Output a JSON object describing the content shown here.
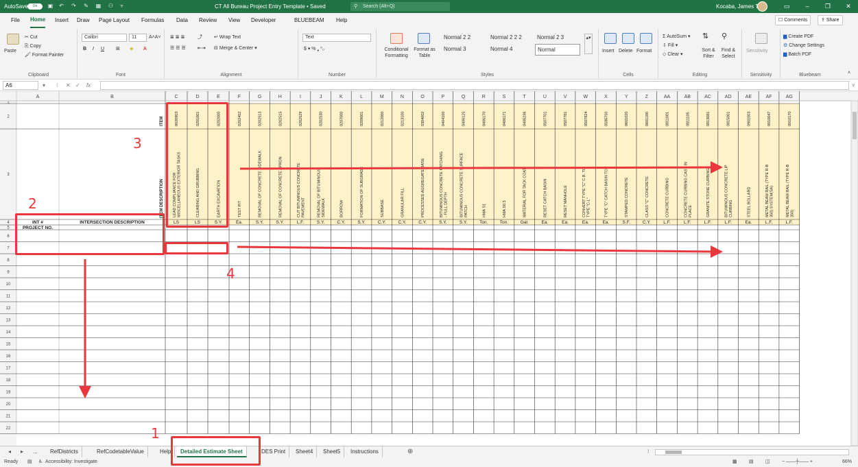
{
  "titlebar": {
    "autosave_label": "AutoSave",
    "autosave_state": "On",
    "doc_title": "CT All Bureau Project Entry Template • Saved",
    "search_placeholder": "Search (Alt+Q)",
    "user_name": "Kocaba, James T"
  },
  "menu": {
    "tabs": [
      "File",
      "Home",
      "Insert",
      "Draw",
      "Page Layout",
      "Formulas",
      "Data",
      "Review",
      "View",
      "Developer",
      "BLUEBEAM",
      "Help"
    ],
    "active": "Home",
    "comments": "Comments",
    "share": "Share"
  },
  "ribbon": {
    "clipboard": {
      "label": "Clipboard",
      "paste": "Paste",
      "cut": "Cut",
      "copy": "Copy",
      "format_painter": "Format Painter"
    },
    "font": {
      "label": "Font",
      "name": "Calibri",
      "size": "11"
    },
    "alignment": {
      "label": "Alignment",
      "wrap": "Wrap Text",
      "merge": "Merge & Center"
    },
    "number": {
      "label": "Number",
      "format": "Text"
    },
    "styles": {
      "label": "Styles",
      "conditional": "Conditional Formatting",
      "format_table": "Format as Table",
      "cells": [
        "Normal 2 2",
        "Normal 2 2 2",
        "Normal 2 3",
        "Normal 3",
        "Normal 4",
        "Normal"
      ]
    },
    "cells": {
      "label": "Cells",
      "insert": "Insert",
      "delete": "Delete",
      "format": "Format"
    },
    "editing": {
      "label": "Editing",
      "autosum": "AutoSum",
      "fill": "Fill",
      "clear": "Clear",
      "sort": "Sort & Filter",
      "find": "Find & Select"
    },
    "sensitivity": {
      "label": "Sensitivity",
      "button": "Sensitivity"
    },
    "bluebeam": {
      "label": "Bluebeam",
      "create_pdf": "Create PDF",
      "change_settings": "Change Settings",
      "batch_pdf": "Batch PDF"
    }
  },
  "formula_bar": {
    "name_box": "A6",
    "fx": "fx",
    "value": ""
  },
  "sheet": {
    "columns": [
      "A",
      "B",
      "C",
      "D",
      "E",
      "F",
      "G",
      "H",
      "I",
      "J",
      "K",
      "L",
      "M",
      "N",
      "O",
      "P",
      "Q",
      "R",
      "S",
      "T",
      "U",
      "V",
      "W",
      "X",
      "Y",
      "Z",
      "AA",
      "AB",
      "AC",
      "AD",
      "AE",
      "AF",
      "AG"
    ],
    "row_numbers": [
      "1",
      "2",
      "3",
      "4",
      "5",
      "6",
      "7",
      "8",
      "9",
      "10",
      "11",
      "12",
      "13",
      "14",
      "15",
      "16",
      "17",
      "18",
      "19",
      "20",
      "21",
      "22",
      "23"
    ],
    "item_label": "ITEM",
    "item_desc_label": "ITEM DESCRIPTION",
    "int_header": "INT #",
    "intersection_header": "INTERSECTION DESCRIPTION",
    "project_no": "PROJECT NO.",
    "items": [
      {
        "code": "0020903",
        "desc": "LEAD COMPLIANCE FOR MISCELLANEOUS EXTERIOR TASKS",
        "unit": "LS"
      },
      {
        "code": "0201001",
        "desc": "CLEARING AND GRUBBING",
        "unit": "LS"
      },
      {
        "code": "0202000",
        "desc": "EARTH EXCAVATION",
        "unit": "S.Y."
      },
      {
        "code": "0202452",
        "desc": "TEST PIT",
        "unit": "Ea."
      },
      {
        "code": "0202513",
        "desc": "REMOVAL OF CONCRETE SIDEWALK",
        "unit": "S.Y."
      },
      {
        "code": "0202515",
        "desc": "REMOVAL OF CONCRETE APRON",
        "unit": "S.Y."
      },
      {
        "code": "0202529",
        "desc": "CUT BITUMINOUS CONCRETE PAVEMENT",
        "unit": "L.F."
      },
      {
        "code": "0202530",
        "desc": "REMOVAL OF BITUMINOUS SIDEWALK",
        "unit": "S.Y."
      },
      {
        "code": "0207000",
        "desc": "BORROW",
        "unit": "C.Y."
      },
      {
        "code": "0209001",
        "desc": "FORMATION OF SUBGRADE",
        "unit": "S.Y."
      },
      {
        "code": "0212000",
        "desc": "SUBBASE",
        "unit": "C.Y."
      },
      {
        "code": "0213100",
        "desc": "GRANULAR FILL",
        "unit": "C.Y."
      },
      {
        "code": "0304002",
        "desc": "PROCESSED AGGREGATE BASE",
        "unit": "C.Y."
      },
      {
        "code": "0404100",
        "desc": "BITUMINOUS CONCRETE PATCHING - FULL DEPTH",
        "unit": "S.Y."
      },
      {
        "code": "0406125",
        "desc": "BITUMINOUS CONCRETE SURFACE PATCH",
        "unit": "S.Y."
      },
      {
        "code": "0406170",
        "desc": "HMA S1",
        "unit": "Ton."
      },
      {
        "code": "0406171",
        "desc": "HMA S0.5",
        "unit": "Ton."
      },
      {
        "code": "0406236",
        "desc": "MATERIAL FOR TACK COAT",
        "unit": "Gal."
      },
      {
        "code": "0507701",
        "desc": "RESET CATCH BASIN",
        "unit": "Ea."
      },
      {
        "code": "0507781",
        "desc": "RESET MANHOLE",
        "unit": "Ea."
      },
      {
        "code": "0507824",
        "desc": "CONVERT TYPE \"C\" C.B. TO TYPE \"C-L\"",
        "unit": "Ea."
      },
      {
        "code": "0586750",
        "desc": "TYPE \"C\" CATCH BASIN TOP",
        "unit": "Ea."
      },
      {
        "code": "0601020",
        "desc": "STAMPED CONCRETE",
        "unit": "S.F."
      },
      {
        "code": "0601180",
        "desc": "CLASS \"C\" CONCRETE",
        "unit": "C.Y."
      },
      {
        "code": "0811001",
        "desc": "CONCRETE CURBING",
        "unit": "L.F."
      },
      {
        "code": "0811105",
        "desc": "CONCRETE CURBING CAST IN PLACE",
        "unit": "L.F."
      },
      {
        "code": "0813081",
        "desc": "GRANITE STONE CURBING",
        "unit": "L.F."
      },
      {
        "code": "0815001",
        "desc": "BITUMINOUS CONCRETE LIP CURBING",
        "unit": "L.F."
      },
      {
        "code": "0901003",
        "desc": "STEEL BOLLARD",
        "unit": "Ea."
      },
      {
        "code": "0910047",
        "desc": "METAL BEAM RAIL (TYPE R-B 350) SYSTEM(SA)",
        "unit": "L.F."
      },
      {
        "code": "0910170",
        "desc": "METAL BEAM RAIL (TYPE R-B 350)",
        "unit": "L.F."
      }
    ]
  },
  "tabs": {
    "items": [
      "RefDistricts",
      "RefCodetableValue",
      "Help",
      "Detailed Estimate Sheet",
      "DES Print",
      "Sheet4",
      "Sheet5",
      "Instructions"
    ],
    "active": "Detailed Estimate Sheet",
    "more": "..."
  },
  "status": {
    "ready": "Ready",
    "accessibility": "Accessibility: Investigate",
    "zoom": "66%"
  },
  "annotations": {
    "labels": [
      "1",
      "2",
      "3",
      "4"
    ],
    "color": "#e8383d"
  },
  "colors": {
    "excel_green": "#217346",
    "header_fill": "#fff2c8",
    "annotation": "#e8383d"
  }
}
